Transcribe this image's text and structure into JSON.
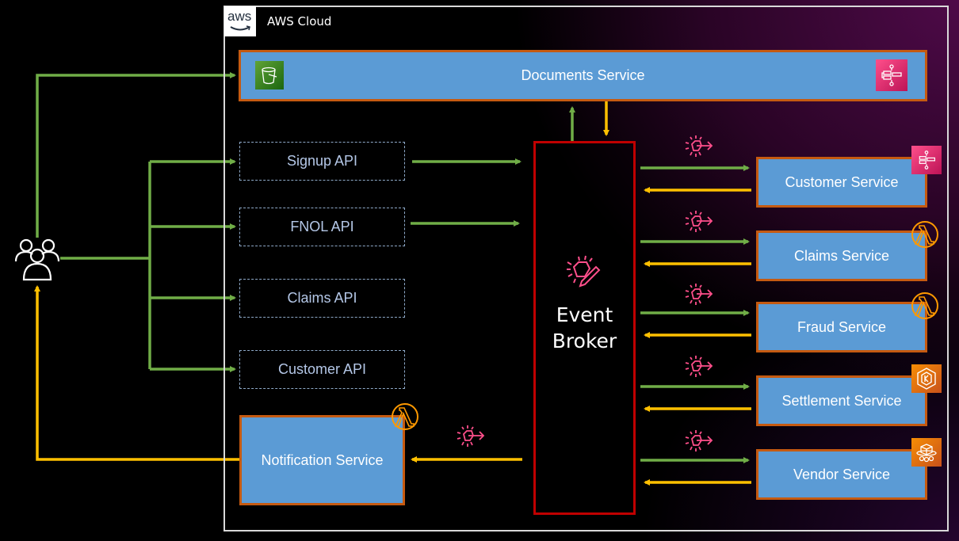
{
  "cloud": {
    "title": "AWS Cloud",
    "logo_text": "aws",
    "logo_icon": "aws-logo"
  },
  "colors": {
    "request_arrow": "#70ad47",
    "response_arrow": "#ffc000",
    "service_fill": "#5b9bd5",
    "service_border": "#c55a11",
    "broker_border": "#c00000",
    "event_icon": "#ff4f8b"
  },
  "users": {
    "icon": "users-group-icon"
  },
  "documents": {
    "label": "Documents Service",
    "icons": [
      "s3-bucket-icon",
      "step-functions-icon"
    ]
  },
  "apis": [
    {
      "label": "Signup API"
    },
    {
      "label": "FNOL API"
    },
    {
      "label": "Claims API"
    },
    {
      "label": "Customer API"
    }
  ],
  "broker": {
    "line1": "Event",
    "line2": "Broker",
    "icon": "eventbridge-icon"
  },
  "notification": {
    "label": "Notification Service",
    "icon": "lambda-icon"
  },
  "services": [
    {
      "label": "Customer Service",
      "icon": "step-functions-icon"
    },
    {
      "label": "Claims Service",
      "icon": "lambda-icon"
    },
    {
      "label": "Fraud Service",
      "icon": "lambda-icon"
    },
    {
      "label": "Settlement Service",
      "icon": "eks-icon"
    },
    {
      "label": "Vendor Service",
      "icon": "ecs-fargate-icon"
    }
  ]
}
